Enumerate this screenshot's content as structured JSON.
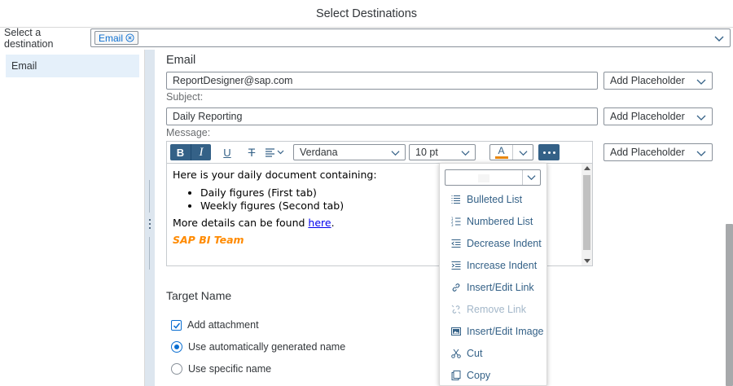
{
  "dialog": {
    "title": "Select Destinations"
  },
  "destination": {
    "label": "Select a destination",
    "tokens": [
      "Email"
    ]
  },
  "sidebar": {
    "items": [
      {
        "label": "Email"
      }
    ]
  },
  "email": {
    "section_title": "Email",
    "to_value": "ReportDesigner@sap.com",
    "subject_label": "Subject:",
    "subject_value": "Daily Reporting",
    "message_label": "Message:",
    "placeholder_label": "Add Placeholder"
  },
  "toolbar": {
    "bold": "B",
    "italic": "I",
    "underline": "U",
    "strike": "T",
    "font_family": "Verdana",
    "font_size": "10 pt",
    "font_color_letter": "A",
    "font_color": "#e8870e"
  },
  "message": {
    "intro": "Here is your daily document containing:",
    "bullets": [
      "Daily figures (First tab)",
      "Weekly figures (Second tab)"
    ],
    "details_prefix": "More details can be found ",
    "details_link": "here",
    "details_suffix": ".",
    "signature": "SAP BI Team"
  },
  "target": {
    "title": "Target Name",
    "add_attachment": "Add attachment",
    "auto_name": "Use automatically generated name",
    "specific_name": "Use specific name"
  },
  "more_menu": {
    "items": [
      {
        "label": "Bulleted List",
        "icon": "bulleted-list-icon",
        "enabled": true
      },
      {
        "label": "Numbered List",
        "icon": "numbered-list-icon",
        "enabled": true
      },
      {
        "label": "Decrease Indent",
        "icon": "decrease-indent-icon",
        "enabled": true
      },
      {
        "label": "Increase Indent",
        "icon": "increase-indent-icon",
        "enabled": true
      },
      {
        "label": "Insert/Edit Link",
        "icon": "link-icon",
        "enabled": true
      },
      {
        "label": "Remove Link",
        "icon": "unlink-icon",
        "enabled": false
      },
      {
        "label": "Insert/Edit Image",
        "icon": "image-icon",
        "enabled": true
      },
      {
        "label": "Cut",
        "icon": "scissors-icon",
        "enabled": true
      },
      {
        "label": "Copy",
        "icon": "copy-icon",
        "enabled": true
      }
    ]
  },
  "colors": {
    "accent": "#346187",
    "link": "#0a6ed1",
    "signature": "#ff8a00"
  }
}
